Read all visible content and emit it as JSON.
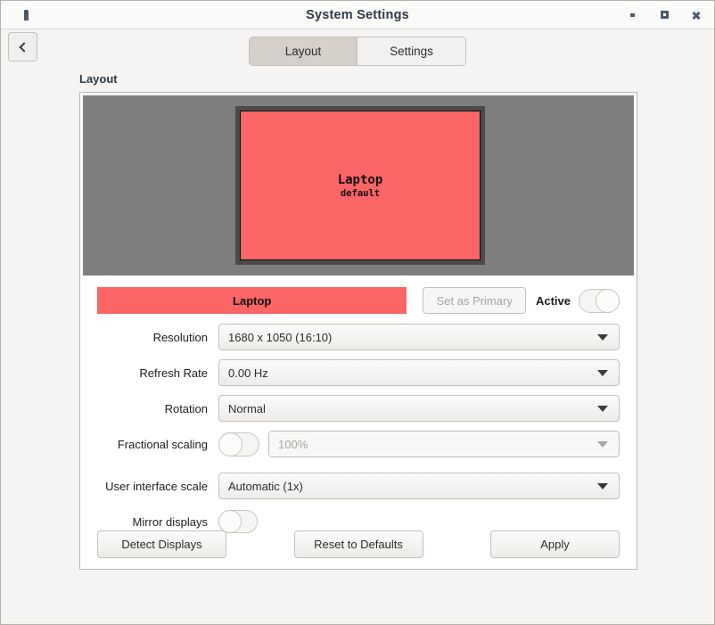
{
  "window": {
    "title": "System Settings",
    "app_icon": "app-icon",
    "controls": {
      "minimize": "minimize",
      "maximize": "maximize",
      "close": "close"
    }
  },
  "toolbar": {
    "back_icon": "back-chevron-icon",
    "tabs": [
      {
        "label": "Layout",
        "active": true
      },
      {
        "label": "Settings",
        "active": false
      }
    ]
  },
  "section": {
    "label": "Layout"
  },
  "preview": {
    "monitor": {
      "name": "Laptop",
      "subtitle": "default"
    },
    "backdrop_color": "#7e7e7e",
    "monitor_color": "#fb6565",
    "frame_color": "#4a4a4a"
  },
  "monitor_bar": {
    "name": "Laptop",
    "set_as_primary_label": "Set as Primary",
    "set_as_primary_enabled": false,
    "active_label": "Active",
    "active_toggle_state": "off"
  },
  "fields": {
    "resolution": {
      "label": "Resolution",
      "value": "1680 x 1050 (16:10)"
    },
    "refresh_rate": {
      "label": "Refresh Rate",
      "value": "0.00 Hz"
    },
    "rotation": {
      "label": "Rotation",
      "value": "Normal"
    },
    "fractional_scaling": {
      "label": "Fractional scaling",
      "toggle_state": "off",
      "value": "100%",
      "enabled": false
    },
    "ui_scale": {
      "label": "User interface scale",
      "value": "Automatic (1x)"
    },
    "mirror_displays": {
      "label": "Mirror displays",
      "toggle_state": "off"
    }
  },
  "actions": {
    "detect": "Detect Displays",
    "reset": "Reset to Defaults",
    "apply": "Apply"
  }
}
